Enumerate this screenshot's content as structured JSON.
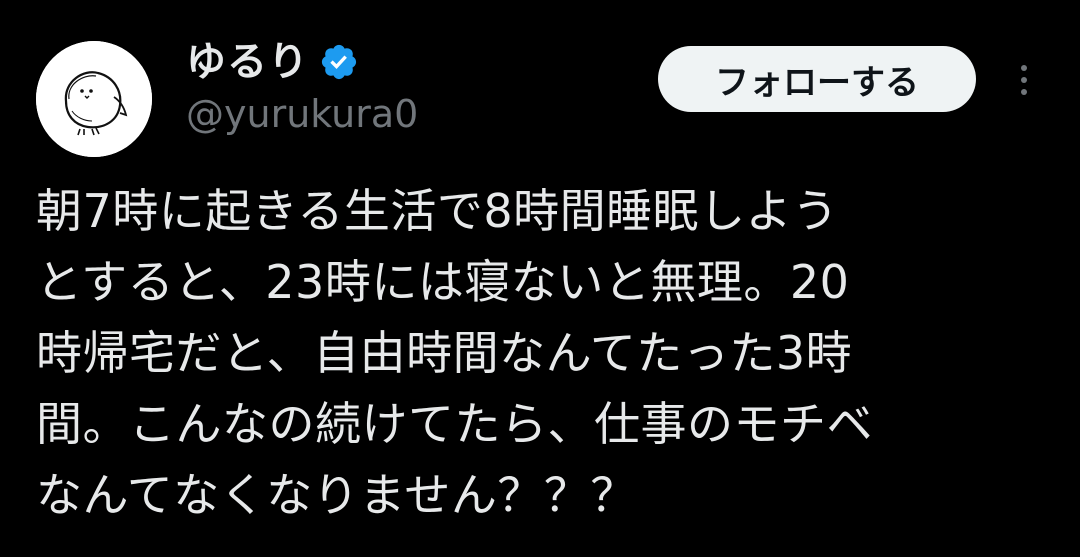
{
  "author": {
    "display_name": "ゆるり",
    "handle": "@yurukura0",
    "verified": true,
    "verified_color": "#1d9bf0"
  },
  "actions": {
    "follow_label": "フォローする",
    "more_icon": "more-vertical-icon"
  },
  "tweet": {
    "lines": [
      "朝7時に起きる生活で8時間睡眠しよう",
      "とすると、23時には寝ないと無理。20",
      "時帰宅だと、自由時間なんてたった3時",
      "間。こんなの続けてたら、仕事のモチベ",
      "なんてなくなりません？？？"
    ]
  },
  "colors": {
    "background": "#000000",
    "primary_text": "#e7e9ea",
    "secondary_text": "#71767b",
    "button_bg": "#eff3f4",
    "button_text": "#0f1419"
  }
}
